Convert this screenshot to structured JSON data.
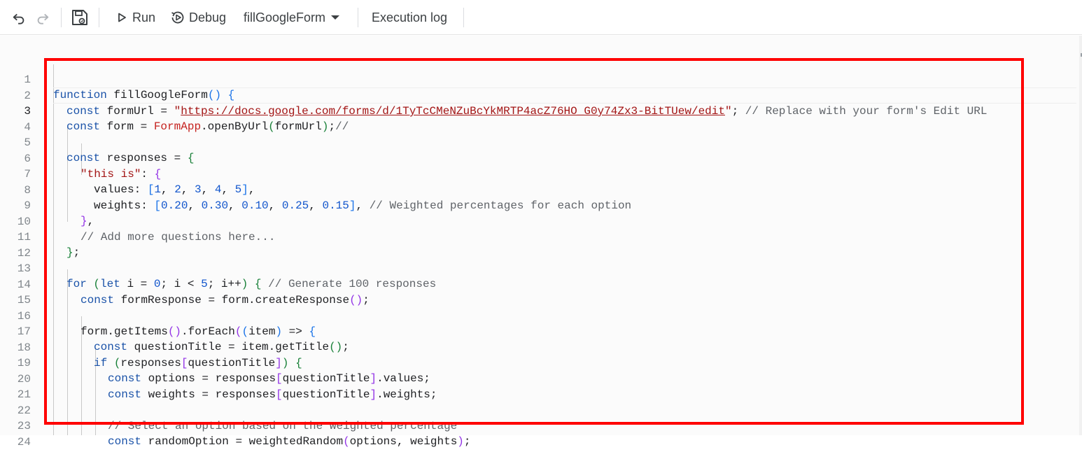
{
  "toolbar": {
    "undo_icon": "undo-icon",
    "redo_icon": "redo-icon",
    "save_icon": "save-icon",
    "run_label": "Run",
    "debug_label": "Debug",
    "function_selected": "fillGoogleForm",
    "execution_log_label": "Execution log"
  },
  "editor": {
    "line_numbers": [
      "1",
      "2",
      "3",
      "4",
      "5",
      "6",
      "7",
      "8",
      "9",
      "10",
      "11",
      "12",
      "13",
      "14",
      "15",
      "16",
      "17",
      "18",
      "19",
      "20",
      "21",
      "22",
      "23",
      "24"
    ],
    "current_line": "3",
    "tokens": {
      "l1_kw": "function",
      "l1_rest": " fillGoogleForm",
      "l1_paren": "()",
      "l1_brace": " {",
      "l2_kw": "const",
      "l2_a": " formUrl = ",
      "l2_q1": "\"",
      "l2_url": "https://docs.google.com/forms/d/1TyTcCMeNZuBcYkMRTP4acZ76HO_G0y74Zx3-BitTUew/edit",
      "l2_q2": "\"",
      "l2_b": "; ",
      "l2_comment": "// Replace with your form's Edit URL",
      "l3_kw": "const",
      "l3_a": " form = ",
      "l3_cls": "FormApp",
      "l3_b": ".openByUrl",
      "l3_p1": "(",
      "l3_arg": "formUrl",
      "l3_p2": ")",
      "l3_c": ";",
      "l3_comment": "//",
      "l5_kw": "const",
      "l5_a": " responses = ",
      "l5_b": "{",
      "l6_str": "\"this is\"",
      "l6_a": ": ",
      "l6_b": "{",
      "l7_a": "values: ",
      "l7_b": "[",
      "l7_n1": "1",
      "l7_s1": ", ",
      "l7_n2": "2",
      "l7_s2": ", ",
      "l7_n3": "3",
      "l7_s3": ", ",
      "l7_n4": "4",
      "l7_s4": ", ",
      "l7_n5": "5",
      "l7_c": "]",
      "l7_d": ",",
      "l8_a": "weights: ",
      "l8_b": "[",
      "l8_n1": "0.20",
      "l8_s1": ", ",
      "l8_n2": "0.30",
      "l8_s2": ", ",
      "l8_n3": "0.10",
      "l8_s3": ", ",
      "l8_n4": "0.25",
      "l8_s4": ", ",
      "l8_n5": "0.15",
      "l8_c": "]",
      "l8_d": ", ",
      "l8_comment": "// Weighted percentages for each option",
      "l9_a": "}",
      "l9_b": ",",
      "l10_comment": "// Add more questions here...",
      "l11_a": "}",
      "l11_b": ";",
      "l13_kw": "for",
      "l13_sp": " ",
      "l13_p1": "(",
      "l13_kw2": "let",
      "l13_a": " i = ",
      "l13_n0": "0",
      "l13_b": "; i < ",
      "l13_n5": "5",
      "l13_c": "; i++",
      "l13_p2": ")",
      "l13_d": " ",
      "l13_brace": "{",
      "l13_e": " ",
      "l13_comment": "// Generate 100 responses",
      "l14_kw": "const",
      "l14_a": " formResponse = form.createResponse",
      "l14_p": "()",
      "l14_b": ";",
      "l16_a": "form.getItems",
      "l16_p1": "()",
      "l16_b": ".forEach",
      "l16_p2": "(",
      "l16_p3": "(",
      "l16_arg": "item",
      "l16_p4": ")",
      "l16_c": " => ",
      "l16_brace": "{",
      "l17_kw": "const",
      "l17_a": " questionTitle = item.getTitle",
      "l17_p": "()",
      "l17_b": ";",
      "l18_kw": "if",
      "l18_sp": " ",
      "l18_p1": "(",
      "l18_a": "responses",
      "l18_b1": "[",
      "l18_arg": "questionTitle",
      "l18_b2": "]",
      "l18_p2": ")",
      "l18_c": " ",
      "l18_brace": "{",
      "l19_kw": "const",
      "l19_a": " options = responses",
      "l19_b1": "[",
      "l19_arg": "questionTitle",
      "l19_b2": "]",
      "l19_c": ".values;",
      "l20_kw": "const",
      "l20_a": " weights = responses",
      "l20_b1": "[",
      "l20_arg": "questionTitle",
      "l20_b2": "]",
      "l20_c": ".weights;",
      "l22_comment": "// Select an option based on the weighted percentage",
      "l23_kw": "const",
      "l23_a": " randomOption = weightedRandom",
      "l23_p1": "(",
      "l23_arg": "options, weights",
      "l23_p2": ")",
      "l23_b": ";"
    }
  },
  "colors": {
    "keyword": "#1a52a8",
    "string": "#a31515",
    "comment": "#5f6368",
    "number": "#1155cc",
    "highlight_box": "#ff0000"
  }
}
